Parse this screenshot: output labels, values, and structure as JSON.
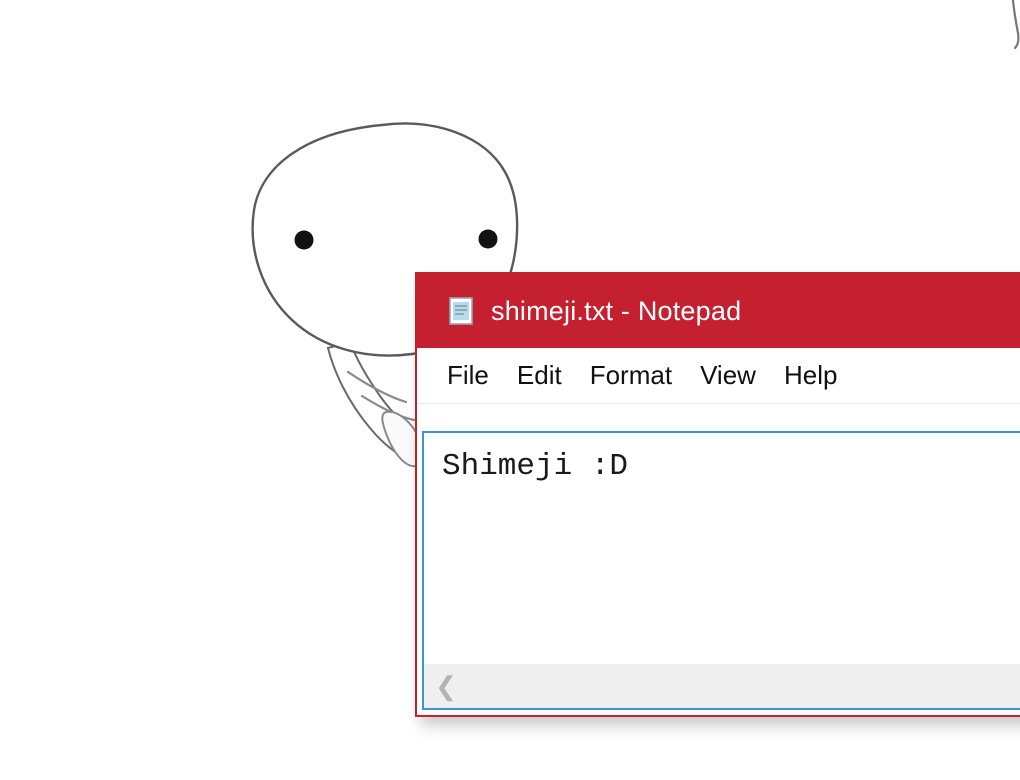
{
  "desktop": {
    "background_color": "#ffffff"
  },
  "mascot": {
    "name": "shimeji-mascot",
    "description": "white blob character peeking over the notepad window",
    "body_color": "#ffffff",
    "outline_color": "#555555",
    "eye_color": "#111111"
  },
  "window": {
    "title": "shimeji.txt - Notepad",
    "app_icon": "notepad-icon",
    "accent_color": "#C4202F",
    "border_color": "#C4202F",
    "editor_border_color": "#3C94D8",
    "menu": [
      {
        "label": "File"
      },
      {
        "label": "Edit"
      },
      {
        "label": "Format"
      },
      {
        "label": "View"
      },
      {
        "label": "Help"
      }
    ],
    "editor": {
      "content": "Shimeji :D",
      "background_color": "#ffffff",
      "text_color": "#1a1a1a"
    },
    "scrollbar": {
      "orientation": "horizontal",
      "left_arrow_glyph": "❮",
      "track_color": "#EFEFEF",
      "arrow_color": "#b3b3b3"
    }
  }
}
